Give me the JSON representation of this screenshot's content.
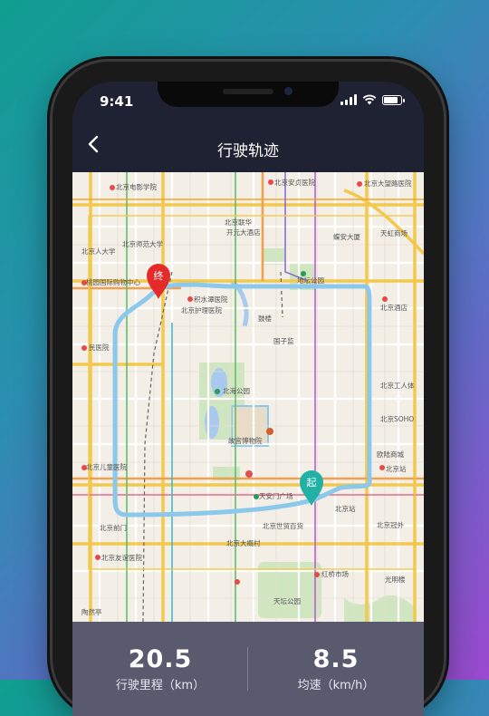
{
  "status_bar": {
    "time": "9:41"
  },
  "nav": {
    "back_icon": "chevron-left-icon",
    "title": "行驶轨迹"
  },
  "map": {
    "end_marker": "终",
    "start_marker": "起",
    "end_color": "#e52a2a",
    "start_color": "#22b1a5",
    "route_color": "#8cc8ec",
    "labels": {
      "l1": "北京电影学院",
      "l2": "北京安贞医院",
      "l3": "北京大望路医院",
      "l4": "天虹商场",
      "l5": "北京师范大学",
      "l6": "北京联华",
      "l7": "开元大酒店",
      "l8": "蝶安大厦",
      "l9": "桃园国际购物中心",
      "l10": "地坛公园",
      "l11": "积水潭医院",
      "l12": "北京护理医院",
      "l13": "鼓楼",
      "l14": "北京酒店",
      "l15": "国子监",
      "l16": "民医院",
      "l17": "北海公园",
      "l18": "故宫博物院",
      "l19": "北京工人体",
      "l20": "北京儿童医院",
      "l21": "天安门广场",
      "l22": "北京站",
      "l23": "北京前门",
      "l24": "北京大概村",
      "l25": "北京友谊医院",
      "l26": "北京SOHO",
      "l27": "天坛公园",
      "l28": "红桥市场",
      "l29": "北京冠外",
      "l30": "光明楼",
      "l31": "北京世贸百货",
      "l32": "欧陆商城",
      "l33": "北京站",
      "l34": "北京人大学",
      "l35": "陶然亭"
    }
  },
  "stats": {
    "distance": {
      "value": "20.5",
      "label": "行驶里程（km）"
    },
    "speed": {
      "value": "8.5",
      "label": "均速（km/h）"
    }
  }
}
